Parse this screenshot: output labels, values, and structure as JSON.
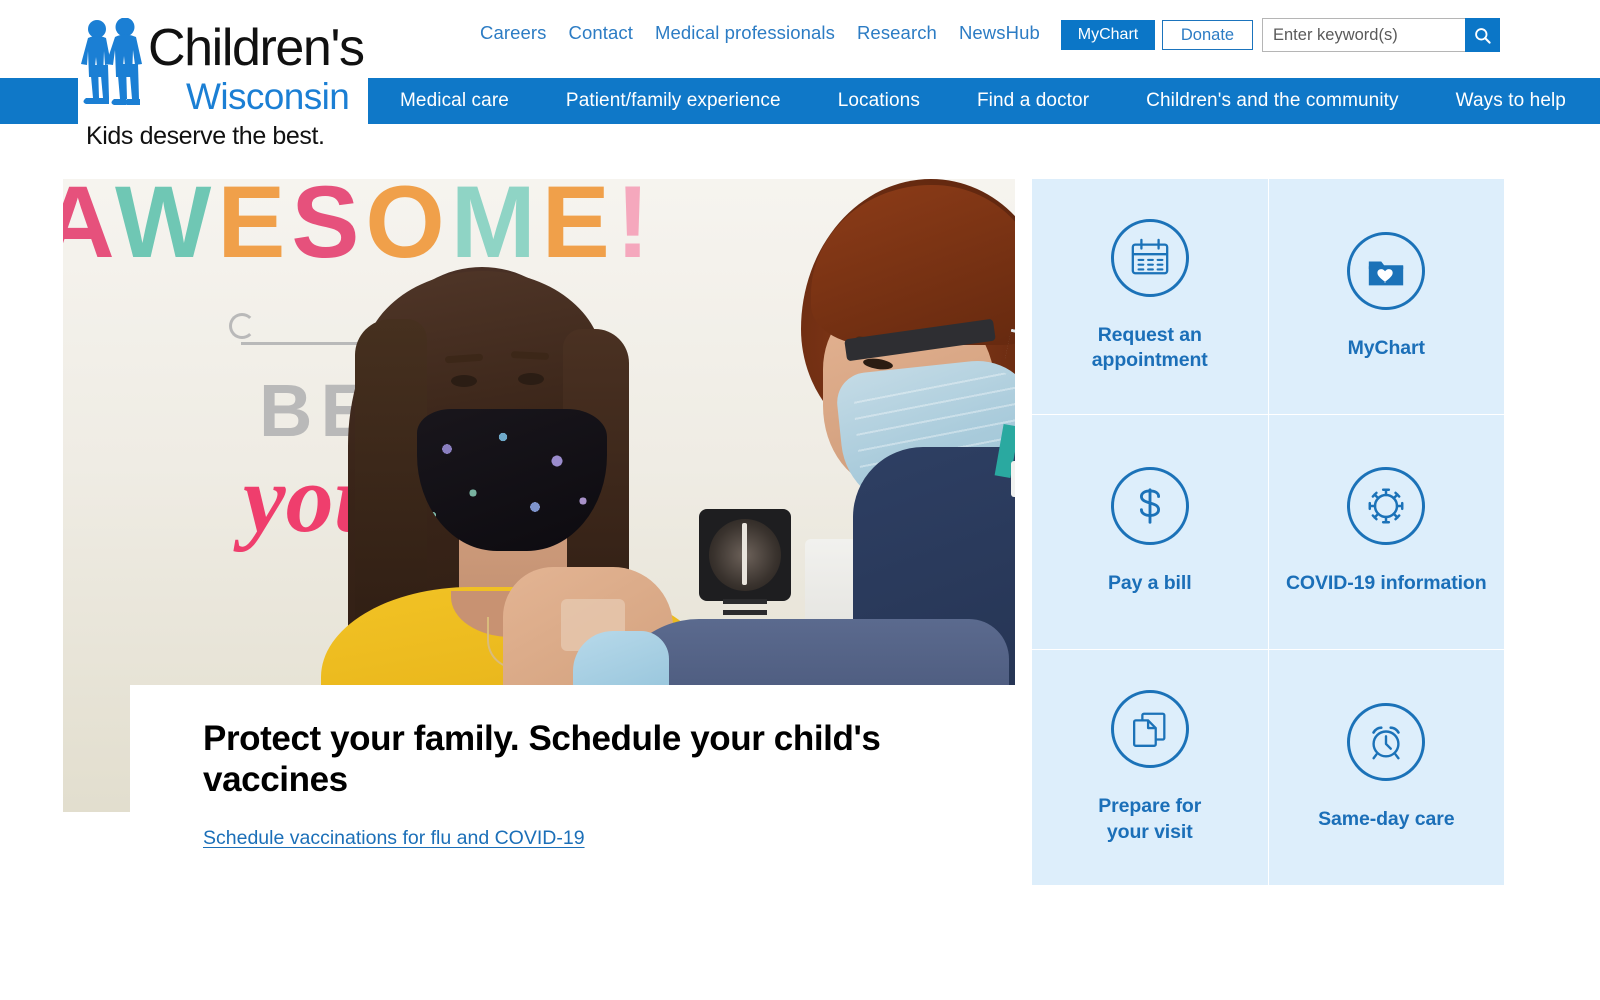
{
  "brand": {
    "name_line1": "Children's",
    "name_line2": "Wisconsin",
    "tagline": "Kids deserve the best.",
    "primary_blue": "#0f78c8",
    "link_blue": "#1b6fb8",
    "tile_bg": "#ddeefb"
  },
  "utility": {
    "links": [
      {
        "label": "Careers"
      },
      {
        "label": "Contact"
      },
      {
        "label": "Medical professionals"
      },
      {
        "label": "Research"
      },
      {
        "label": "NewsHub"
      }
    ],
    "mychart_label": "MyChart",
    "donate_label": "Donate",
    "search": {
      "placeholder": "Enter keyword(s)",
      "value": "",
      "button_icon": "search-icon"
    }
  },
  "main_nav": {
    "items": [
      {
        "label": "Medical care"
      },
      {
        "label": "Patient/family experience"
      },
      {
        "label": "Locations"
      },
      {
        "label": "Find a doctor"
      },
      {
        "label": "Children's and the community"
      },
      {
        "label": "Ways to help"
      }
    ]
  },
  "hero": {
    "image_alt": "Girl wearing a floral face mask receiving a vaccination from a masked nurse in a clinic exam room",
    "wall_art": {
      "word_top": "AWESOME",
      "word_middle": "BE",
      "word_bottom": "you"
    },
    "title": "Protect your family. Schedule your child's vaccines",
    "link_label": "Schedule vaccinations for flu and COVID-19"
  },
  "quicklinks": {
    "tiles": [
      {
        "label": "Request an\nappointment",
        "icon": "calendar-icon"
      },
      {
        "label": "MyChart",
        "icon": "folder-heart-icon"
      },
      {
        "label": "Pay a bill",
        "icon": "dollar-icon"
      },
      {
        "label": "COVID-19 information",
        "icon": "virus-icon"
      },
      {
        "label": "Prepare for\nyour visit",
        "icon": "documents-icon"
      },
      {
        "label": "Same-day care",
        "icon": "alarm-clock-icon"
      }
    ]
  }
}
